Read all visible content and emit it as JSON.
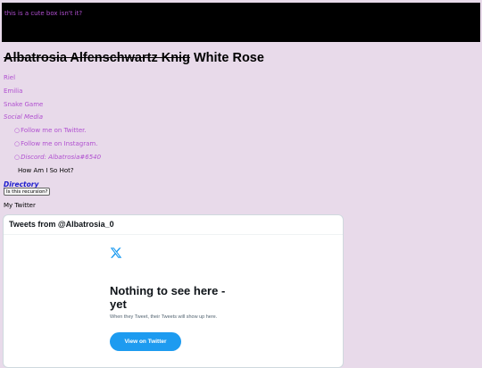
{
  "banner": {
    "text": "this is a cute box isn't it?"
  },
  "title": {
    "struck": "Albatrosia Alfenschwartz Knig",
    "rest": " White Rose"
  },
  "nav": {
    "items": [
      "Riel",
      "Emilia",
      "Snake Game"
    ],
    "social_label": "Social Media",
    "social": [
      {
        "bullet": "○",
        "label": "Follow me on Twitter."
      },
      {
        "bullet": "○",
        "label": "Follow me on Instagram."
      },
      {
        "bullet": "○",
        "label": "Discord: Albatrosia#6540"
      }
    ],
    "hot": "How Am I So Hot?"
  },
  "directory": "Directory",
  "recursion_button": "Is this recursion?",
  "my_twitter": "My Twitter",
  "twitter_embed": {
    "header": "Tweets from @Albatrosia_0",
    "logo_icon": "x-logo-icon",
    "heading": "Nothing to see here - yet",
    "description": "When they Tweet, their Tweets will show up here.",
    "button": "View on Twitter"
  },
  "colors": {
    "background": "#e8daea",
    "link": "#b04fd0",
    "directory": "#1a1acc",
    "twitter_blue": "#1d9bf0"
  }
}
